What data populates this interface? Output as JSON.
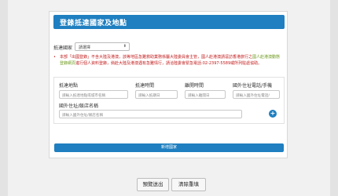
{
  "form": {
    "title": "登錄抵達國家及地點",
    "country_label": "抵達國家",
    "country_select": {
      "value": "請選擇"
    },
    "notice": {
      "bullet": "•",
      "text_pre": "本部「出國登錄」不含大陸及港澳，該等地區急難救助業務係屬大陸委員會主管，國人赴港澳請逕訪香港旅行之",
      "text_highlight": "國人赴港澳動態登錄網頁",
      "text_post": "進行個人資料登錄，倘赴大陸及港澳遇有急難情行，請洽陸委會緊急電話:02-2397-5589或所列駐處協助。"
    },
    "section": {
      "columns": {
        "place": "抵達地點",
        "arrive_time": "抵達時間",
        "leave_time": "離開時間",
        "phone": "國外住址電話/手機",
        "address": "國外住址/飯店名稱"
      },
      "placeholders": {
        "place": "請輸入抵達地點或城市名稱",
        "arrive_time": "請輸入抵期日",
        "leave_time": "請輸入離開日",
        "phone": "請輸入國外住址電話/",
        "address": "請輸入國外住址/飯店名稱"
      },
      "add_row_icon": "plus-circle-icon"
    },
    "add_country_button": "新增國家"
  },
  "actions": {
    "preview": "預覽送出",
    "reset": "清除重填"
  },
  "colors": {
    "accent": "#1f7fc0",
    "warning": "#c21a1a",
    "highlight": "#6e9a1f"
  }
}
